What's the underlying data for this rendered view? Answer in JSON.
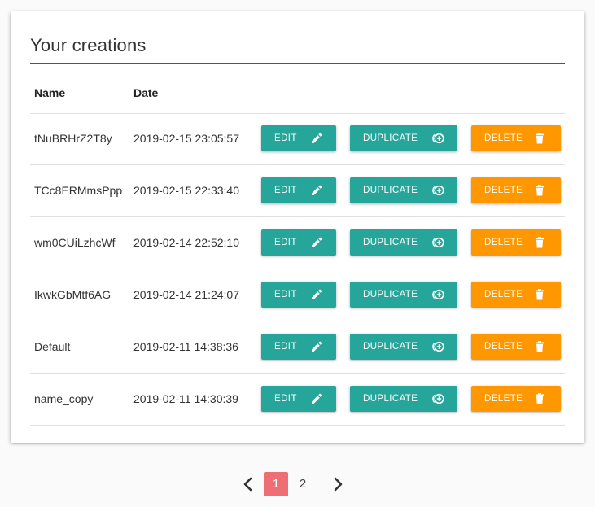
{
  "section": {
    "title": "Your creations"
  },
  "table": {
    "headers": {
      "name": "Name",
      "date": "Date"
    },
    "rows": [
      {
        "name": "tNuBRHrZ2T8y",
        "date": "2019-02-15 23:05:57"
      },
      {
        "name": "TCc8ERMmsPpp",
        "date": "2019-02-15 22:33:40"
      },
      {
        "name": "wm0CUiLzhcWf",
        "date": "2019-02-14 22:52:10"
      },
      {
        "name": "IkwkGbMtf6AG",
        "date": "2019-02-14 21:24:07"
      },
      {
        "name": "Default",
        "date": "2019-02-11 14:38:36"
      },
      {
        "name": "name_copy",
        "date": "2019-02-11 14:30:39"
      }
    ],
    "actions": {
      "edit": "EDIT",
      "duplicate": "DUPLICATE",
      "delete": "DELETE"
    }
  },
  "pagination": {
    "pages": [
      "1",
      "2"
    ],
    "current": "1"
  },
  "colors": {
    "teal": "#26a69a",
    "orange": "#ff9800",
    "active_page": "#ee6e73"
  },
  "icons": {
    "edit": "pencil-icon",
    "duplicate": "copy-circle-icon",
    "delete": "trash-icon",
    "prev": "chevron-left-icon",
    "next": "chevron-right-icon"
  }
}
